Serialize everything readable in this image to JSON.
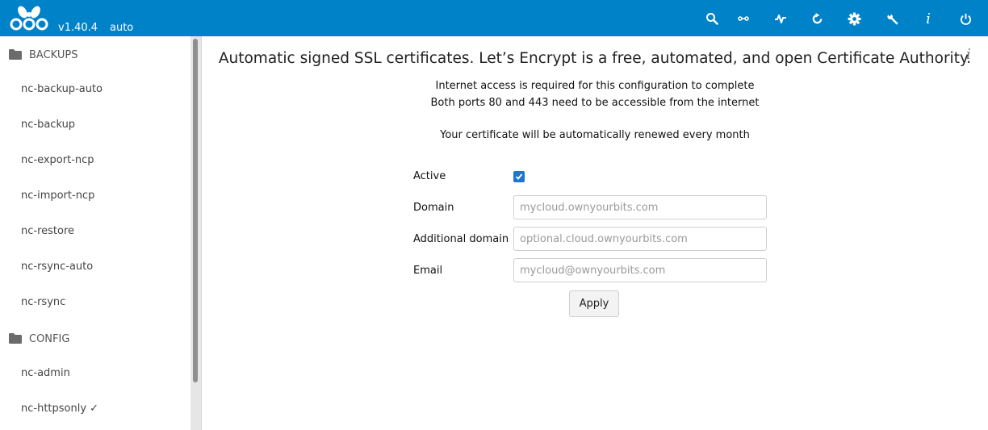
{
  "header": {
    "version": "v1.40.4",
    "mode": "auto",
    "icons": [
      "search-icon",
      "link-icon",
      "pulse-icon",
      "refresh-icon",
      "gear-icon",
      "wrench-icon",
      "info-icon",
      "power-icon"
    ],
    "background": "#0082c9"
  },
  "sidebar": {
    "categories": [
      {
        "label": "BACKUPS",
        "items": [
          "nc-backup-auto",
          "nc-backup",
          "nc-export-ncp",
          "nc-import-ncp",
          "nc-restore",
          "nc-rsync-auto",
          "nc-rsync"
        ]
      },
      {
        "label": "CONFIG",
        "items": [
          "nc-admin",
          "nc-httpsonly ✓"
        ]
      }
    ]
  },
  "main": {
    "info_glyph": "i",
    "headline": "Automatic signed SSL certificates. Let’s Encrypt is a free, automated, and open Certificate Authority.",
    "lines": [
      "Internet access is required for this configuration to complete",
      "Both ports 80 and 443 need to be accessible from the internet",
      "Your certificate will be automatically renewed every month"
    ],
    "form": {
      "active_label": "Active",
      "active_checked": true,
      "domain_label": "Domain",
      "domain_value": "",
      "domain_placeholder": "mycloud.ownyourbits.com",
      "additional_label": "Additional domain",
      "additional_value": "",
      "additional_placeholder": "optional.cloud.ownyourbits.com",
      "email_label": "Email",
      "email_value": "",
      "email_placeholder": "mycloud@ownyourbits.com",
      "apply_label": "Apply"
    }
  }
}
